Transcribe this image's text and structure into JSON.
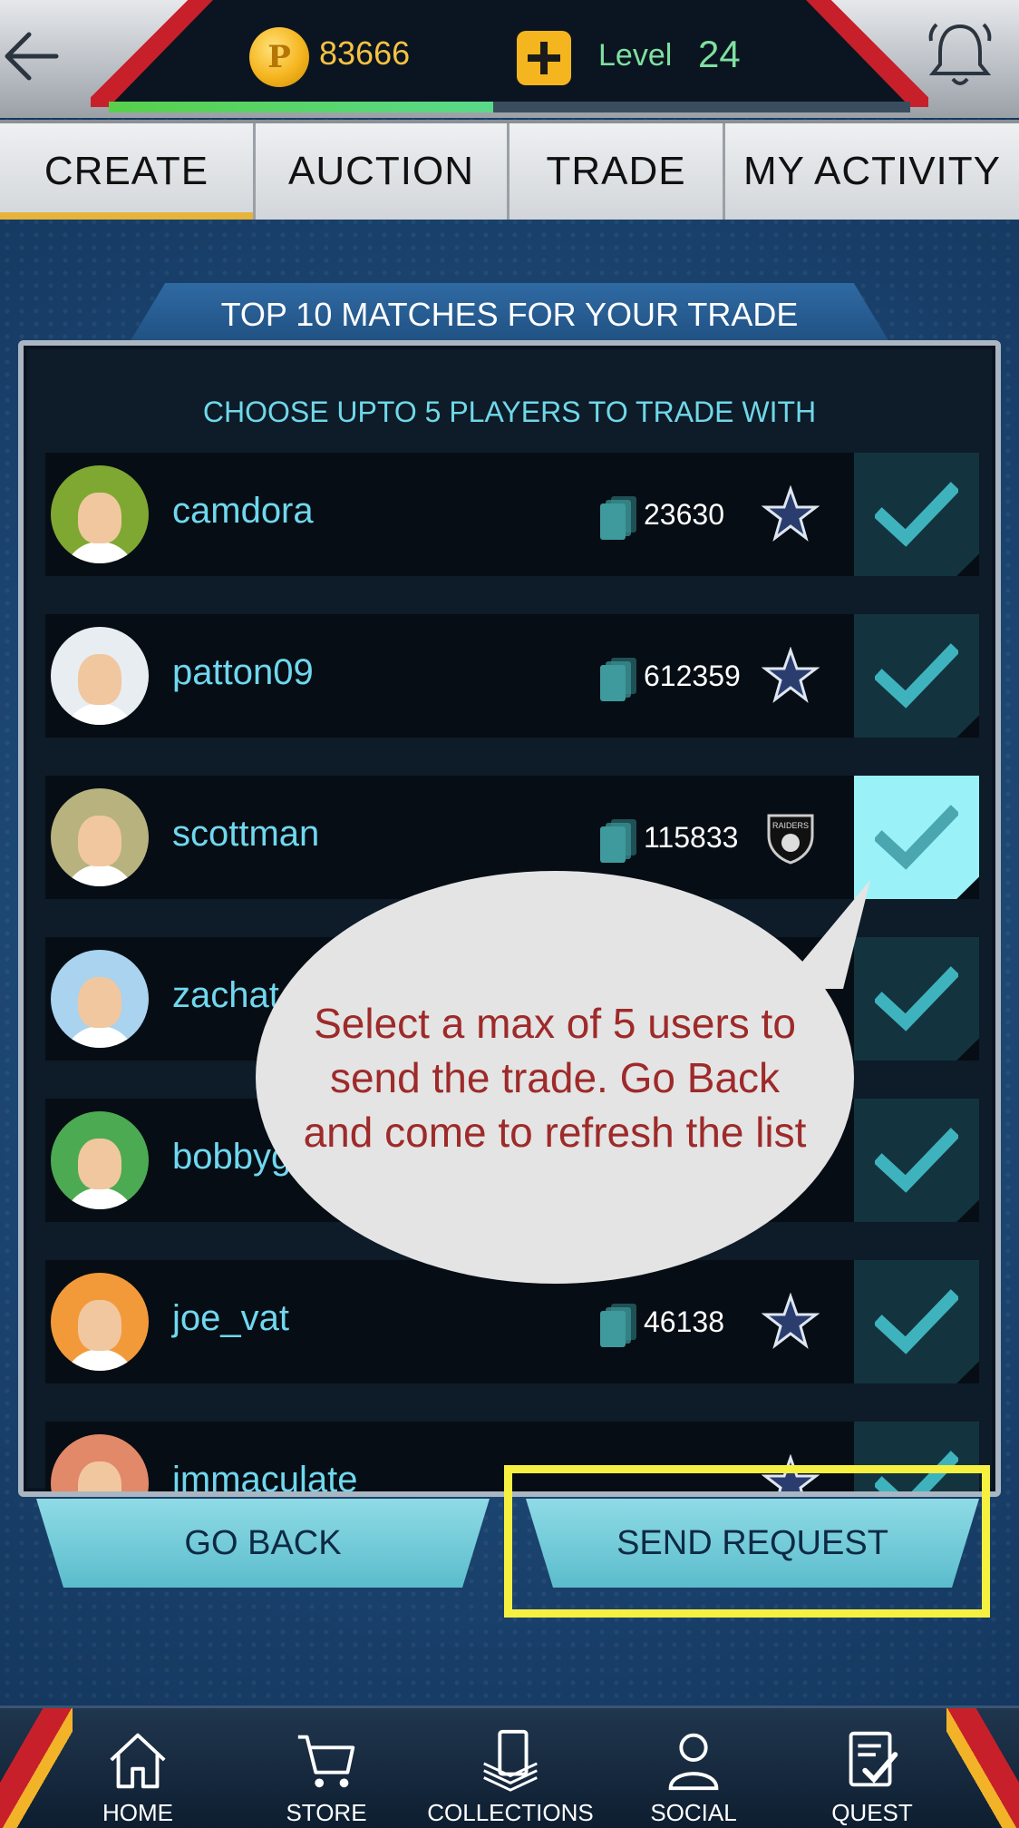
{
  "header": {
    "coins": "83666",
    "coin_symbol": "P",
    "level_label": "Level",
    "level_value": "24",
    "xp_progress_fraction": 0.48
  },
  "tabs": [
    {
      "label": "CREATE",
      "active": true
    },
    {
      "label": "AUCTION",
      "active": false
    },
    {
      "label": "TRADE",
      "active": false
    },
    {
      "label": "MY ACTIVITY",
      "active": false
    }
  ],
  "panel": {
    "title": "TOP 10 MATCHES FOR YOUR TRADE",
    "subtitle": "CHOOSE UPTO 5 PLAYERS TO TRADE WITH"
  },
  "players": [
    {
      "username": "camdora",
      "cards": "23630",
      "team_icon": "star-icon",
      "selected": false,
      "avatar_bg": "#7ea832"
    },
    {
      "username": "patton09",
      "cards": "612359",
      "team_icon": "star-icon",
      "selected": false,
      "avatar_bg": "#e8edf2"
    },
    {
      "username": "scottman",
      "cards": "115833",
      "team_icon": "raiders-shield-icon",
      "team_text": "RAIDERS",
      "selected": true,
      "avatar_bg": "#b8b27e"
    },
    {
      "username": "zachat",
      "cards": "",
      "team_icon": "",
      "selected": false,
      "avatar_bg": "#a9d3ee"
    },
    {
      "username": "bobbyg",
      "cards": "",
      "team_icon": "",
      "selected": false,
      "avatar_bg": "#4caa52"
    },
    {
      "username": "joe_vat",
      "cards": "46138",
      "team_icon": "star-icon",
      "selected": false,
      "avatar_bg": "#f29a3a"
    },
    {
      "username": "immaculate",
      "cards": "",
      "team_icon": "star-icon",
      "selected": false,
      "avatar_bg": "#e2896a"
    }
  ],
  "buttons": {
    "go_back": "GO BACK",
    "send_request": "SEND REQUEST"
  },
  "callout": {
    "text": "Select a max of 5 users to send the trade. Go Back and come to refresh the list"
  },
  "bottom_nav": [
    {
      "label": "HOME",
      "icon": "home-icon"
    },
    {
      "label": "STORE",
      "icon": "cart-icon"
    },
    {
      "label": "COLLECTIONS",
      "icon": "cards-stack-icon"
    },
    {
      "label": "SOCIAL",
      "icon": "person-icon"
    },
    {
      "label": "QUEST",
      "icon": "checklist-icon"
    }
  ],
  "colors": {
    "accent_cyan": "#6fd8ef",
    "highlight_yellow": "#f6f041",
    "callout_text": "#9e2a2a",
    "coin_gold": "#f5c242",
    "level_green": "#7fe0a0"
  }
}
